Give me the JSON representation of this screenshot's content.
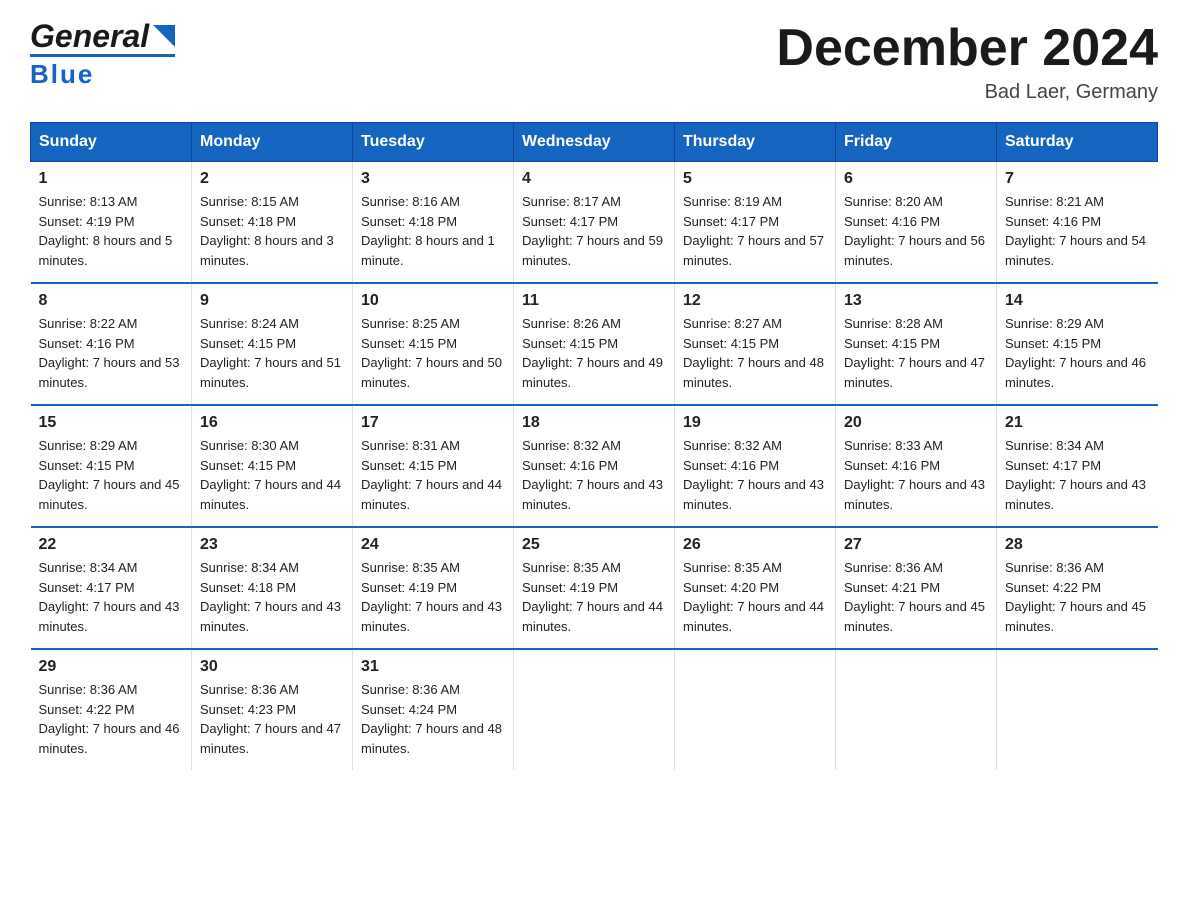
{
  "logo": {
    "line1": "General",
    "triangle": "▶",
    "line2": "Blue"
  },
  "title": "December 2024",
  "location": "Bad Laer, Germany",
  "days_of_week": [
    "Sunday",
    "Monday",
    "Tuesday",
    "Wednesday",
    "Thursday",
    "Friday",
    "Saturday"
  ],
  "weeks": [
    [
      {
        "day": "1",
        "sunrise": "8:13 AM",
        "sunset": "4:19 PM",
        "daylight": "8 hours and 5 minutes."
      },
      {
        "day": "2",
        "sunrise": "8:15 AM",
        "sunset": "4:18 PM",
        "daylight": "8 hours and 3 minutes."
      },
      {
        "day": "3",
        "sunrise": "8:16 AM",
        "sunset": "4:18 PM",
        "daylight": "8 hours and 1 minute."
      },
      {
        "day": "4",
        "sunrise": "8:17 AM",
        "sunset": "4:17 PM",
        "daylight": "7 hours and 59 minutes."
      },
      {
        "day": "5",
        "sunrise": "8:19 AM",
        "sunset": "4:17 PM",
        "daylight": "7 hours and 57 minutes."
      },
      {
        "day": "6",
        "sunrise": "8:20 AM",
        "sunset": "4:16 PM",
        "daylight": "7 hours and 56 minutes."
      },
      {
        "day": "7",
        "sunrise": "8:21 AM",
        "sunset": "4:16 PM",
        "daylight": "7 hours and 54 minutes."
      }
    ],
    [
      {
        "day": "8",
        "sunrise": "8:22 AM",
        "sunset": "4:16 PM",
        "daylight": "7 hours and 53 minutes."
      },
      {
        "day": "9",
        "sunrise": "8:24 AM",
        "sunset": "4:15 PM",
        "daylight": "7 hours and 51 minutes."
      },
      {
        "day": "10",
        "sunrise": "8:25 AM",
        "sunset": "4:15 PM",
        "daylight": "7 hours and 50 minutes."
      },
      {
        "day": "11",
        "sunrise": "8:26 AM",
        "sunset": "4:15 PM",
        "daylight": "7 hours and 49 minutes."
      },
      {
        "day": "12",
        "sunrise": "8:27 AM",
        "sunset": "4:15 PM",
        "daylight": "7 hours and 48 minutes."
      },
      {
        "day": "13",
        "sunrise": "8:28 AM",
        "sunset": "4:15 PM",
        "daylight": "7 hours and 47 minutes."
      },
      {
        "day": "14",
        "sunrise": "8:29 AM",
        "sunset": "4:15 PM",
        "daylight": "7 hours and 46 minutes."
      }
    ],
    [
      {
        "day": "15",
        "sunrise": "8:29 AM",
        "sunset": "4:15 PM",
        "daylight": "7 hours and 45 minutes."
      },
      {
        "day": "16",
        "sunrise": "8:30 AM",
        "sunset": "4:15 PM",
        "daylight": "7 hours and 44 minutes."
      },
      {
        "day": "17",
        "sunrise": "8:31 AM",
        "sunset": "4:15 PM",
        "daylight": "7 hours and 44 minutes."
      },
      {
        "day": "18",
        "sunrise": "8:32 AM",
        "sunset": "4:16 PM",
        "daylight": "7 hours and 43 minutes."
      },
      {
        "day": "19",
        "sunrise": "8:32 AM",
        "sunset": "4:16 PM",
        "daylight": "7 hours and 43 minutes."
      },
      {
        "day": "20",
        "sunrise": "8:33 AM",
        "sunset": "4:16 PM",
        "daylight": "7 hours and 43 minutes."
      },
      {
        "day": "21",
        "sunrise": "8:34 AM",
        "sunset": "4:17 PM",
        "daylight": "7 hours and 43 minutes."
      }
    ],
    [
      {
        "day": "22",
        "sunrise": "8:34 AM",
        "sunset": "4:17 PM",
        "daylight": "7 hours and 43 minutes."
      },
      {
        "day": "23",
        "sunrise": "8:34 AM",
        "sunset": "4:18 PM",
        "daylight": "7 hours and 43 minutes."
      },
      {
        "day": "24",
        "sunrise": "8:35 AM",
        "sunset": "4:19 PM",
        "daylight": "7 hours and 43 minutes."
      },
      {
        "day": "25",
        "sunrise": "8:35 AM",
        "sunset": "4:19 PM",
        "daylight": "7 hours and 44 minutes."
      },
      {
        "day": "26",
        "sunrise": "8:35 AM",
        "sunset": "4:20 PM",
        "daylight": "7 hours and 44 minutes."
      },
      {
        "day": "27",
        "sunrise": "8:36 AM",
        "sunset": "4:21 PM",
        "daylight": "7 hours and 45 minutes."
      },
      {
        "day": "28",
        "sunrise": "8:36 AM",
        "sunset": "4:22 PM",
        "daylight": "7 hours and 45 minutes."
      }
    ],
    [
      {
        "day": "29",
        "sunrise": "8:36 AM",
        "sunset": "4:22 PM",
        "daylight": "7 hours and 46 minutes."
      },
      {
        "day": "30",
        "sunrise": "8:36 AM",
        "sunset": "4:23 PM",
        "daylight": "7 hours and 47 minutes."
      },
      {
        "day": "31",
        "sunrise": "8:36 AM",
        "sunset": "4:24 PM",
        "daylight": "7 hours and 48 minutes."
      },
      null,
      null,
      null,
      null
    ]
  ],
  "labels": {
    "sunrise": "Sunrise:",
    "sunset": "Sunset:",
    "daylight": "Daylight:"
  }
}
